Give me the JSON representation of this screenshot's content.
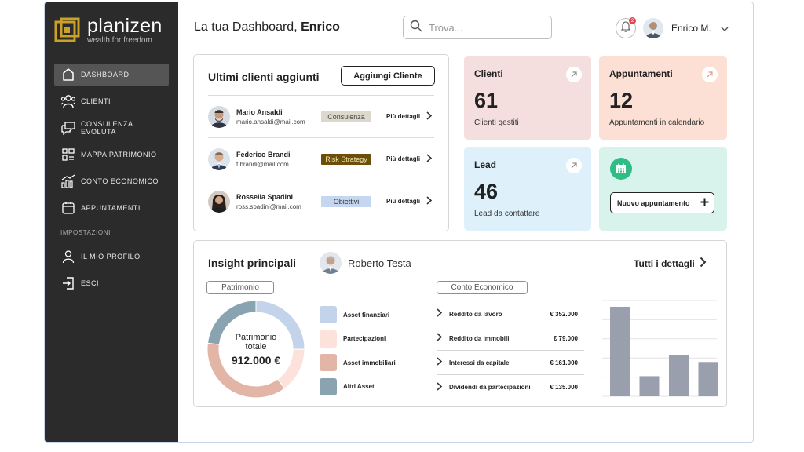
{
  "brand": {
    "name": "planizen",
    "tagline": "wealth for freedom",
    "gold": "#c9a227"
  },
  "sidebar": {
    "items": [
      {
        "label": "DASHBOARD",
        "icon": "home-icon",
        "active": true
      },
      {
        "label": "CLIENTI",
        "icon": "users-icon"
      },
      {
        "label": "CONSULENZA EVOLUTA",
        "icon": "chat-icon"
      },
      {
        "label": "MAPPA PATRIMONIO",
        "icon": "grid-icon"
      },
      {
        "label": "CONTO ECONOMICO",
        "icon": "chart-icon"
      },
      {
        "label": "APPUNTAMENTI",
        "icon": "calendar-icon"
      }
    ],
    "section_label": "IMPOSTAZIONI",
    "settings": [
      {
        "label": "IL MIO PROFILO",
        "icon": "user-icon"
      },
      {
        "label": "ESCI",
        "icon": "logout-icon"
      }
    ]
  },
  "header": {
    "title_prefix": "La tua Dashboard, ",
    "title_name": "Enrico",
    "search_placeholder": "Trova...",
    "notification_count": "2",
    "user_name": "Enrico M."
  },
  "clients_panel": {
    "title": "Ultimi clienti aggiunti",
    "add_button": "Aggiungi Cliente",
    "rows": [
      {
        "name": "Mario Ansaldi",
        "email": "mario.ansaldi@mail.com",
        "tag": "Consulenza",
        "tag_bg": "#dcd8cc",
        "tag_color": "#444444",
        "more": "Più dettagli"
      },
      {
        "name": "Federico Brandi",
        "email": "f.brandi@mail.com",
        "tag": "Risk Strategy",
        "tag_bg": "#6b4e07",
        "tag_color": "#f3e6b6",
        "more": "Più dettagli"
      },
      {
        "name": "Rossella Spadini",
        "email": "ross.spadini@mail.com",
        "tag": "Obiettivi",
        "tag_bg": "#c4d6f0",
        "tag_color": "#333333",
        "more": "Più dettagli"
      }
    ]
  },
  "stats": {
    "clienti": {
      "title": "Clienti",
      "value": "61",
      "subtitle": "Clienti gestiti"
    },
    "appuntamenti": {
      "title": "Appuntamenti",
      "value": "12",
      "subtitle": "Appuntamenti in calendario"
    },
    "lead": {
      "title": "Lead",
      "value": "46",
      "subtitle": "Lead da contattare"
    },
    "new_appointment": {
      "button": "Nuovo appuntamento"
    }
  },
  "insight": {
    "title": "Insight principali",
    "person": "Roberto Testa",
    "all_details": "Tutti i dettagli",
    "patrimonio_label": "Patrimonio",
    "donut_center_label_1": "Patrimonio",
    "donut_center_label_2": "totale",
    "donut_center_value": "912.000 €",
    "conto_label": "Conto Economico",
    "conto_rows": [
      {
        "label": "Reddito da lavoro",
        "value": "€ 352.000"
      },
      {
        "label": "Reddito da immobili",
        "value": "€ 79.000"
      },
      {
        "label": "Interessi da capitale",
        "value": "€ 161.000"
      },
      {
        "label": "Dividendi da partecipazioni",
        "value": "€ 135.000"
      }
    ]
  },
  "chart_data": [
    {
      "type": "pie",
      "title": "Patrimonio",
      "categories": [
        "Asset finanziari",
        "Partecipazioni",
        "Asset immobiliari",
        "Altri Asset"
      ],
      "values": [
        25,
        15,
        37,
        23
      ],
      "colors": [
        "#c2d3ea",
        "#fde2dc",
        "#e3b5a6",
        "#8aa3b0"
      ]
    },
    {
      "type": "bar",
      "categories": [
        "Reddito da lavoro",
        "Reddito da immobili",
        "Interessi da capitale",
        "Dividendi da partecipazioni"
      ],
      "values": [
        352000,
        79000,
        161000,
        135000
      ],
      "ylim": [
        0,
        352000
      ],
      "color": "#9a9fae",
      "grid": true
    }
  ]
}
